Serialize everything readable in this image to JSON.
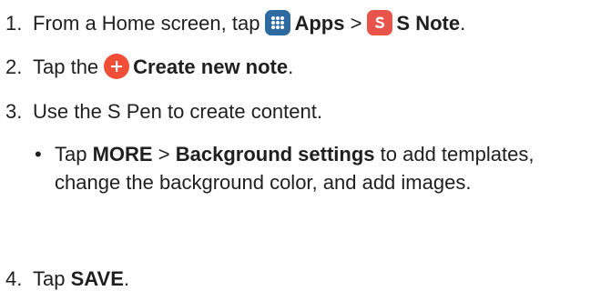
{
  "steps": [
    {
      "number": "1.",
      "text_before": "From a Home screen, tap",
      "apps_label": "Apps",
      "separator": ">",
      "snote_label": "S Note",
      "end": "."
    },
    {
      "number": "2.",
      "text_before": "Tap the",
      "create_label": "Create new note",
      "end": "."
    },
    {
      "number": "3.",
      "text": "Use the S Pen to create content."
    },
    {
      "number": "4.",
      "text_before": "Tap",
      "save_label": "SAVE",
      "end": "."
    }
  ],
  "bullet": {
    "marker": "•",
    "text_before": "Tap",
    "more_label": "MORE",
    "separator": ">",
    "background_label": "Background settings",
    "text_after": "to add templates, change the background color, and add images."
  },
  "icons": {
    "apps": "apps-grid-icon",
    "snote": "s-note-app-icon",
    "create": "plus-circle-icon"
  },
  "colors": {
    "text": "#1f1f1f",
    "apps_icon": "#2d6aa0",
    "snote_icon": "#e8534a",
    "plus_icon": "#f04e37"
  }
}
